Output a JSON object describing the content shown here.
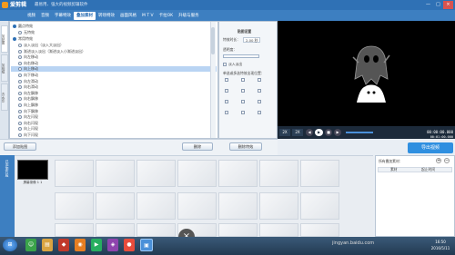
{
  "app": {
    "title": "爱剪辑",
    "slogan": "最易用、强大的视频剪辑软件"
  },
  "window_controls": [
    "—",
    "□",
    "×"
  ],
  "menu": {
    "tabs": [
      "视频",
      "音频",
      "字幕特效",
      "叠加素材",
      "转场特效",
      "画面风格",
      "M T V",
      "卡拉OK",
      "升级与服务"
    ],
    "active": "叠加素材"
  },
  "left_tabs": [
    "加贴图",
    "加相框",
    "去水印"
  ],
  "effects": {
    "group1": "圆点特效",
    "item1": "无特效",
    "group2": "常用特效",
    "items": [
      "淡入淡出（淡入大淡出）",
      "渐进淡入淡出（渐进淡入小渐进淡出）",
      "向左移动",
      "向右移动",
      "向上移动",
      "向下移动",
      "向左滑动",
      "向右滑动",
      "向左飘移",
      "向右飘移",
      "向上飘移",
      "向下飘移",
      "向左闪现",
      "向右闪现",
      "向上闪现",
      "向下闪现"
    ],
    "selected_index": 4
  },
  "props": {
    "header": "贴图设置",
    "duration_label": "特效时长：",
    "duration_value": "2.00 秒",
    "opacity_label": "透明度：",
    "checkbox_label": "淡入淡出",
    "position_label": "单选或多选特效出现位置："
  },
  "actions": {
    "add_sticker": "添加贴图",
    "delete": "删除",
    "apply": "删除特效"
  },
  "player": {
    "time_current": "00:00:00.000",
    "time_total": "00:01:00.000",
    "ratio": "2X",
    "btn_2x": "2X"
  },
  "export": {
    "label": "导出视频"
  },
  "timeline": {
    "side_label": "已添加片段",
    "clip_label": "屏幕录像 1 1",
    "empty_hint": "双击此处添加视频"
  },
  "right_panel": {
    "title": "所有叠加素材：",
    "col1": "素材",
    "col2": "起止时间"
  },
  "taskbar": {
    "time": "16:50",
    "date": "2016/5/11",
    "watermark": "jingyan.baidu.com"
  },
  "colors": {
    "titlebar": "#2f71b5",
    "accent": "#2f8fe0",
    "preview_bg": "#000000"
  }
}
